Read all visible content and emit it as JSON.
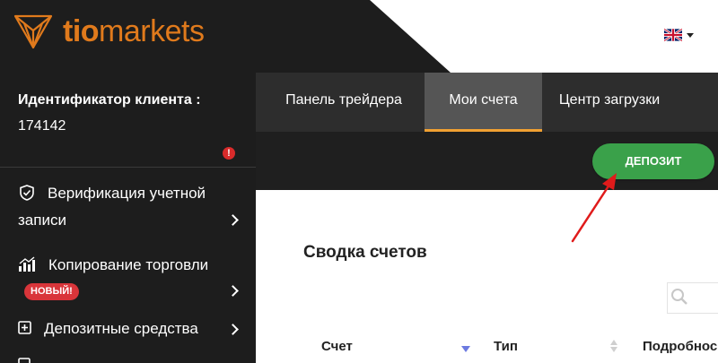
{
  "header": {
    "logo_text_bold": "tio",
    "logo_text_regular": "markets",
    "brand_color": "#e07a1c",
    "language_icon": "uk-flag-icon"
  },
  "sidebar": {
    "client_label": "Идентификатор клиента :",
    "client_id": "174142",
    "alert_mark": "!",
    "items": [
      {
        "label_line1": "Верификация учетной",
        "label_line2": "записи",
        "icon": "shield-check-icon"
      },
      {
        "label": "Копирование торговли",
        "badge": "НОВЫЙ!",
        "icon": "copy-trading-icon"
      },
      {
        "label": "Депозитные средства",
        "icon": "plus-square-icon"
      }
    ]
  },
  "tabs": [
    {
      "label": "Панель трейдера",
      "active": false
    },
    {
      "label": "Мои счета",
      "active": true
    },
    {
      "label": "Центр загрузки",
      "active": false
    }
  ],
  "actions": {
    "deposit_label": "ДЕПОЗИТ",
    "deposit_color": "#3aa14a"
  },
  "main": {
    "section_title": "Сводка счетов",
    "search_icon": "search-icon",
    "columns": [
      "Счет",
      "Тип",
      "Подробнос"
    ]
  },
  "colors": {
    "sidebar_bg": "#1d1d1d",
    "tab_active_underline": "#f0a032",
    "badge_red": "#d9353a",
    "annotation_red": "#e01b1b"
  }
}
